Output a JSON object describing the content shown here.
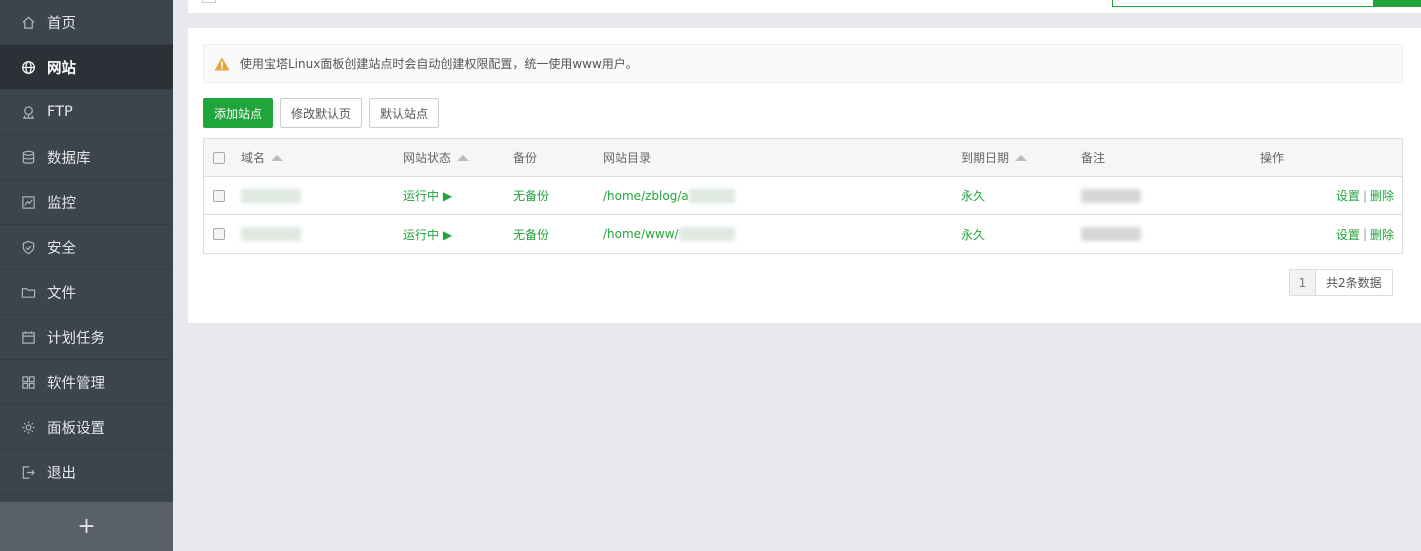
{
  "sidebar": {
    "items": [
      {
        "label": "首页",
        "icon": "home-icon"
      },
      {
        "label": "网站",
        "icon": "globe-icon",
        "active": true
      },
      {
        "label": "FTP",
        "icon": "ftp-icon"
      },
      {
        "label": "数据库",
        "icon": "database-icon"
      },
      {
        "label": "监控",
        "icon": "monitor-icon"
      },
      {
        "label": "安全",
        "icon": "shield-icon"
      },
      {
        "label": "文件",
        "icon": "folder-icon"
      },
      {
        "label": "计划任务",
        "icon": "calendar-icon"
      },
      {
        "label": "软件管理",
        "icon": "apps-icon"
      },
      {
        "label": "面板设置",
        "icon": "gear-icon"
      },
      {
        "label": "退出",
        "icon": "logout-icon"
      }
    ],
    "add_label": "+"
  },
  "notice": {
    "text": "使用宝塔Linux面板创建站点时会自动创建权限配置，统一使用www用户。"
  },
  "toolbar": {
    "add_site": "添加站点",
    "edit_default_page": "修改默认页",
    "default_site": "默认站点"
  },
  "table": {
    "headers": {
      "domain": "域名",
      "status": "网站状态",
      "backup": "备份",
      "directory": "网站目录",
      "expiry": "到期日期",
      "remark": "备注",
      "actions": "操作"
    },
    "rows": [
      {
        "status": "运行中 ▶",
        "backup": "无备份",
        "directory": "/home/zblog/a",
        "expiry": "永久",
        "settings": "设置",
        "separator": "|",
        "delete": "删除"
      },
      {
        "status": "运行中 ▶",
        "backup": "无备份",
        "directory": "/home/www/",
        "expiry": "永久",
        "settings": "设置",
        "separator": "|",
        "delete": "删除"
      }
    ]
  },
  "pager": {
    "current_page": "1",
    "total": "共2条数据"
  },
  "colors": {
    "accent": "#20a53a",
    "sidebar_bg": "#3c444d",
    "sidebar_active": "#2c3138",
    "warning": "#e8a33d"
  }
}
